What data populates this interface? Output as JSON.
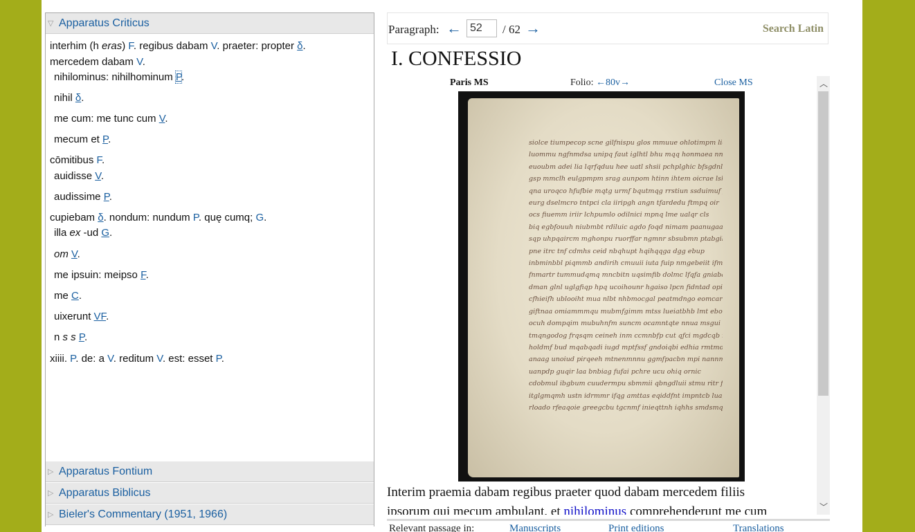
{
  "left_panel": {
    "criticus": {
      "title": "Apparatus Criticus",
      "entries": [
        {
          "segs": [
            {
              "t": "interhim (h "
            },
            {
              "t": "eras",
              "s": "it"
            },
            {
              "t": ") "
            },
            {
              "t": "F",
              "s": "sig"
            },
            {
              "t": ". regibus dabam "
            },
            {
              "t": "V",
              "s": "sig"
            },
            {
              "t": ". praeter: propter "
            },
            {
              "t": "δ",
              "s": "sig u"
            },
            {
              "t": "."
            }
          ]
        },
        {
          "segs": [
            {
              "t": "mercedem dabam "
            },
            {
              "t": "V",
              "s": "sig"
            },
            {
              "t": "."
            }
          ]
        },
        {
          "sub": true,
          "segs": [
            {
              "t": "nihilominus: nihilhominum "
            },
            {
              "t": "P",
              "s": "sig box"
            },
            {
              "t": "."
            }
          ]
        },
        {
          "sub": true,
          "segs": [
            {
              "t": "nihil "
            },
            {
              "t": "δ",
              "s": "sig u"
            },
            {
              "t": "."
            }
          ]
        },
        {
          "sub": true,
          "segs": [
            {
              "t": "me cum: me tunc cum "
            },
            {
              "t": "V",
              "s": "sig u"
            },
            {
              "t": "."
            }
          ]
        },
        {
          "sub": true,
          "segs": [
            {
              "t": "mecum et "
            },
            {
              "t": "P",
              "s": "sig u"
            },
            {
              "t": "."
            }
          ]
        },
        {
          "segs": [
            {
              "t": "cōmitibus "
            },
            {
              "t": "F",
              "s": "sig"
            },
            {
              "t": "."
            }
          ]
        },
        {
          "sub": true,
          "segs": [
            {
              "t": "auidisse "
            },
            {
              "t": "V",
              "s": "sig u"
            },
            {
              "t": "."
            }
          ]
        },
        {
          "sub": true,
          "segs": [
            {
              "t": "audissime "
            },
            {
              "t": "P",
              "s": "sig u"
            },
            {
              "t": "."
            }
          ]
        },
        {
          "segs": [
            {
              "t": "cupiebam "
            },
            {
              "t": "δ",
              "s": "sig u"
            },
            {
              "t": ". nondum: nundum "
            },
            {
              "t": "P",
              "s": "sig"
            },
            {
              "t": ". quę cumq; "
            },
            {
              "t": "G",
              "s": "sig"
            },
            {
              "t": "."
            }
          ]
        },
        {
          "sub": true,
          "segs": [
            {
              "t": "illa "
            },
            {
              "t": "ex",
              "s": "it"
            },
            {
              "t": " -ud "
            },
            {
              "t": "G",
              "s": "sig u"
            },
            {
              "t": "."
            }
          ]
        },
        {
          "sub": true,
          "segs": [
            {
              "t": "om",
              "s": "it"
            },
            {
              "t": " "
            },
            {
              "t": "V",
              "s": "sig u"
            },
            {
              "t": "."
            }
          ]
        },
        {
          "sub": true,
          "segs": [
            {
              "t": "me ipsuin: meipso "
            },
            {
              "t": "F",
              "s": "sig u"
            },
            {
              "t": "."
            }
          ]
        },
        {
          "sub": true,
          "segs": [
            {
              "t": "me "
            },
            {
              "t": "C",
              "s": "sig u"
            },
            {
              "t": "."
            }
          ]
        },
        {
          "sub": true,
          "segs": [
            {
              "t": "uixerunt "
            },
            {
              "t": "VF",
              "s": "sig u"
            },
            {
              "t": "."
            }
          ]
        },
        {
          "sub": true,
          "segs": [
            {
              "t": "n "
            },
            {
              "t": "s s",
              "s": "it"
            },
            {
              "t": " "
            },
            {
              "t": "P",
              "s": "sig u"
            },
            {
              "t": "."
            }
          ]
        },
        {
          "segs": [
            {
              "t": "xiiii. "
            },
            {
              "t": "P",
              "s": "sig"
            },
            {
              "t": ". de: a "
            },
            {
              "t": "V",
              "s": "sig"
            },
            {
              "t": ". reditum "
            },
            {
              "t": "V",
              "s": "sig"
            },
            {
              "t": ". est: esset "
            },
            {
              "t": "P",
              "s": "sig"
            },
            {
              "t": "."
            }
          ]
        }
      ]
    },
    "fontium_title": "Apparatus Fontium",
    "biblicus_title": "Apparatus Biblicus",
    "commentary_title": "Bieler's Commentary (1951, 1966)",
    "expanded_icon": "triangle-down-icon",
    "collapsed_icon": "triangle-right-icon"
  },
  "nav": {
    "label": "Paragraph:",
    "prev_arrow": "←",
    "current": "52",
    "total": "/ 62",
    "next_arrow": "→",
    "search_label": "Search Latin"
  },
  "section_title": "I. CONFESSIO",
  "ms": {
    "name": "Paris  MS",
    "folio_label": "Folio:",
    "folio_prev": "←",
    "folio_value": "80v",
    "folio_next": "→",
    "close_label": "Close MS"
  },
  "latin": {
    "line1": "Interim praemia dabam regibus praeter quod dabam mercedem filiis",
    "line2_before": "ipsorum qui mecum ambulant, et ",
    "line2_link": "nihilominus",
    "line2_after": " comprehenderunt me cum"
  },
  "relevant": {
    "label": "Relevant passage in:",
    "manuscripts": "Manuscripts",
    "print_editions": "Print editions",
    "translations": "Translations"
  },
  "colors": {
    "background_olive": "#a3ad1a",
    "link_blue": "#1a5fa0",
    "search_grey": "#8e8e66"
  }
}
